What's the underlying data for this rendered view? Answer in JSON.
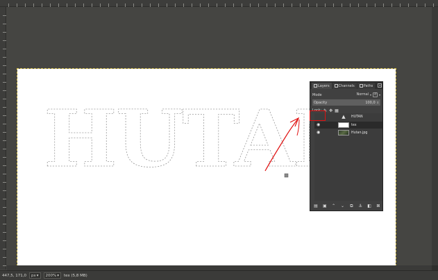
{
  "ruler": {},
  "canvas": {
    "text": "HUTAN"
  },
  "dock": {
    "tabs": [
      {
        "label": "Layers",
        "icon": "layers-icon"
      },
      {
        "label": "Channels",
        "icon": "channels-icon"
      },
      {
        "label": "Paths",
        "icon": "paths-icon"
      }
    ],
    "mode_label": "Mode",
    "mode_value": "Normal",
    "opacity_label": "Opacity",
    "opacity_value": "100,0",
    "lock_label": "Lock:",
    "layers": [
      {
        "name": "HUTAN",
        "thumb": "text",
        "selected": false,
        "visible": false
      },
      {
        "name": "tex",
        "thumb": "white",
        "selected": true,
        "visible": true
      },
      {
        "name": "Hutan.jpg",
        "thumb": "image",
        "selected": false,
        "visible": true
      }
    ],
    "bottom_buttons": [
      "new-layer-icon",
      "new-group-icon",
      "raise-layer-icon",
      "lower-layer-icon",
      "duplicate-layer-icon",
      "anchor-layer-icon",
      "mask-icon",
      "delete-layer-icon"
    ]
  },
  "status": {
    "coords": "447,5, 171,0",
    "unit": "px",
    "zoom": "200%",
    "info": "tex (5,8 MB)"
  },
  "colors": {
    "annotation": "#e01010",
    "canvas_border": "#c9b23a"
  }
}
